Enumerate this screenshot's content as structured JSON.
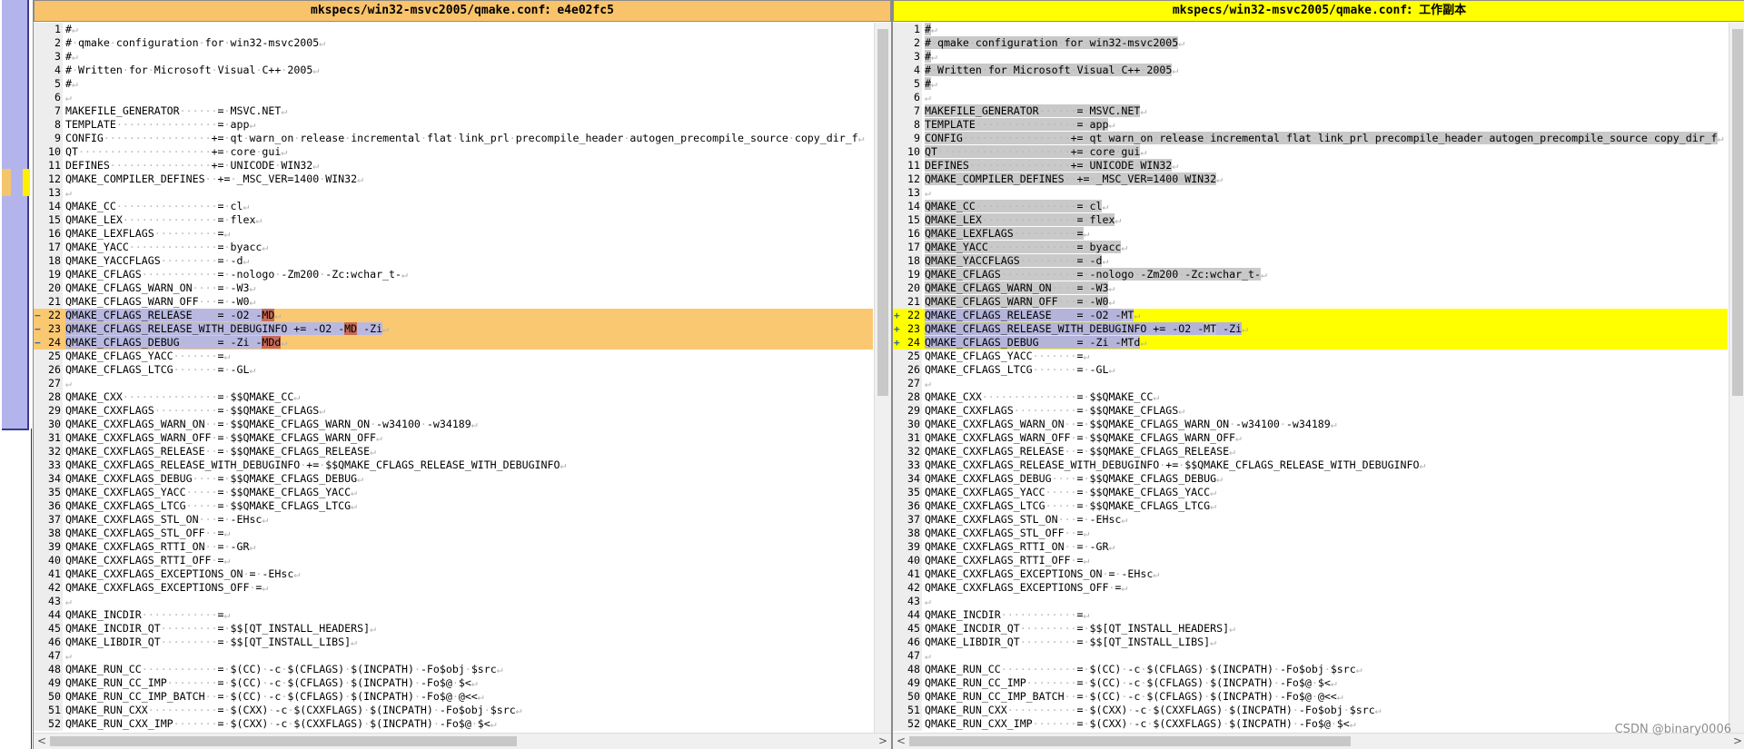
{
  "left_pane": {
    "title_path": "mkspecs/win32-msvc2005/qmake.conf",
    "title_sep": ":",
    "title_rev": "e4e02fc5",
    "lines": [
      {
        "n": 1,
        "parts": [
          [
            "#"
          ]
        ]
      },
      {
        "n": 2,
        "parts": [
          [
            "# qmake configuration for win32-msvc2005"
          ]
        ]
      },
      {
        "n": 3,
        "parts": [
          [
            "#"
          ]
        ]
      },
      {
        "n": 4,
        "parts": [
          [
            "# Written for Microsoft Visual C++ 2005"
          ]
        ]
      },
      {
        "n": 5,
        "parts": [
          [
            "#"
          ]
        ]
      },
      {
        "n": 6,
        "parts": [
          [
            ""
          ]
        ]
      },
      {
        "n": 7,
        "parts": [
          [
            "MAKEFILE_GENERATOR      = MSVC.NET"
          ]
        ]
      },
      {
        "n": 8,
        "parts": [
          [
            "TEMPLATE                = app"
          ]
        ]
      },
      {
        "n": 9,
        "parts": [
          [
            "CONFIG                 += qt warn_on release incremental flat link_prl precompile_header autogen_precompile_source copy_dir_f"
          ]
        ]
      },
      {
        "n": 10,
        "parts": [
          [
            "QT                     += core gui"
          ]
        ]
      },
      {
        "n": 11,
        "parts": [
          [
            "DEFINES                += UNICODE WIN32"
          ]
        ]
      },
      {
        "n": 12,
        "parts": [
          [
            "QMAKE_COMPILER_DEFINES  += _MSC_VER=1400 WIN32"
          ]
        ]
      },
      {
        "n": 13,
        "parts": [
          [
            ""
          ]
        ]
      },
      {
        "n": 14,
        "parts": [
          [
            "QMAKE_CC                = cl"
          ]
        ]
      },
      {
        "n": 15,
        "parts": [
          [
            "QMAKE_LEX               = flex"
          ]
        ]
      },
      {
        "n": 16,
        "parts": [
          [
            "QMAKE_LEXFLAGS          ="
          ]
        ]
      },
      {
        "n": 17,
        "parts": [
          [
            "QMAKE_YACC              = byacc"
          ]
        ]
      },
      {
        "n": 18,
        "parts": [
          [
            "QMAKE_YACCFLAGS         = -d"
          ]
        ]
      },
      {
        "n": 19,
        "parts": [
          [
            "QMAKE_CFLAGS            = -nologo -Zm200 -Zc:wchar_t-"
          ]
        ]
      },
      {
        "n": 20,
        "parts": [
          [
            "QMAKE_CFLAGS_WARN_ON    = -W3"
          ]
        ]
      },
      {
        "n": 21,
        "parts": [
          [
            "QMAKE_CFLAGS_WARN_OFF   = -W0"
          ]
        ]
      },
      {
        "n": 22,
        "marker": "−",
        "changed": true,
        "parts": [
          [
            "QMAKE_CFLAGS_RELEASE    = -O2 -",
            "hl"
          ],
          [
            "MD",
            "del"
          ]
        ]
      },
      {
        "n": 23,
        "marker": "−",
        "changed": true,
        "parts": [
          [
            "QMAKE_CFLAGS_RELEASE_WITH_DEBUGINFO += -O2 -",
            "hl"
          ],
          [
            "MD",
            "del"
          ],
          [
            " -Zi",
            "hl"
          ]
        ]
      },
      {
        "n": 24,
        "marker": "−",
        "changed": true,
        "parts": [
          [
            "QMAKE_CFLAGS_DEBUG      = -Zi -",
            "hl"
          ],
          [
            "MDd",
            "del"
          ]
        ]
      },
      {
        "n": 25,
        "parts": [
          [
            "QMAKE_CFLAGS_YACC       ="
          ]
        ]
      },
      {
        "n": 26,
        "parts": [
          [
            "QMAKE_CFLAGS_LTCG       = -GL"
          ]
        ]
      },
      {
        "n": 27,
        "parts": [
          [
            ""
          ]
        ]
      },
      {
        "n": 28,
        "parts": [
          [
            "QMAKE_CXX               = $$QMAKE_CC"
          ]
        ]
      },
      {
        "n": 29,
        "parts": [
          [
            "QMAKE_CXXFLAGS          = $$QMAKE_CFLAGS"
          ]
        ]
      },
      {
        "n": 30,
        "parts": [
          [
            "QMAKE_CXXFLAGS_WARN_ON  = $$QMAKE_CFLAGS_WARN_ON -w34100 -w34189"
          ]
        ]
      },
      {
        "n": 31,
        "parts": [
          [
            "QMAKE_CXXFLAGS_WARN_OFF = $$QMAKE_CFLAGS_WARN_OFF"
          ]
        ]
      },
      {
        "n": 32,
        "parts": [
          [
            "QMAKE_CXXFLAGS_RELEASE  = $$QMAKE_CFLAGS_RELEASE"
          ]
        ]
      },
      {
        "n": 33,
        "parts": [
          [
            "QMAKE_CXXFLAGS_RELEASE_WITH_DEBUGINFO += $$QMAKE_CFLAGS_RELEASE_WITH_DEBUGINFO"
          ]
        ]
      },
      {
        "n": 34,
        "parts": [
          [
            "QMAKE_CXXFLAGS_DEBUG    = $$QMAKE_CFLAGS_DEBUG"
          ]
        ]
      },
      {
        "n": 35,
        "parts": [
          [
            "QMAKE_CXXFLAGS_YACC     = $$QMAKE_CFLAGS_YACC"
          ]
        ]
      },
      {
        "n": 36,
        "parts": [
          [
            "QMAKE_CXXFLAGS_LTCG     = $$QMAKE_CFLAGS_LTCG"
          ]
        ]
      },
      {
        "n": 37,
        "parts": [
          [
            "QMAKE_CXXFLAGS_STL_ON   = -EHsc"
          ]
        ]
      },
      {
        "n": 38,
        "parts": [
          [
            "QMAKE_CXXFLAGS_STL_OFF  ="
          ]
        ]
      },
      {
        "n": 39,
        "parts": [
          [
            "QMAKE_CXXFLAGS_RTTI_ON  = -GR"
          ]
        ]
      },
      {
        "n": 40,
        "parts": [
          [
            "QMAKE_CXXFLAGS_RTTI_OFF ="
          ]
        ]
      },
      {
        "n": 41,
        "parts": [
          [
            "QMAKE_CXXFLAGS_EXCEPTIONS_ON = -EHsc"
          ]
        ]
      },
      {
        "n": 42,
        "parts": [
          [
            "QMAKE_CXXFLAGS_EXCEPTIONS_OFF ="
          ]
        ]
      },
      {
        "n": 43,
        "parts": [
          [
            ""
          ]
        ]
      },
      {
        "n": 44,
        "parts": [
          [
            "QMAKE_INCDIR            ="
          ]
        ]
      },
      {
        "n": 45,
        "parts": [
          [
            "QMAKE_INCDIR_QT         = $$[QT_INSTALL_HEADERS]"
          ]
        ]
      },
      {
        "n": 46,
        "parts": [
          [
            "QMAKE_LIBDIR_QT         = $$[QT_INSTALL_LIBS]"
          ]
        ]
      },
      {
        "n": 47,
        "parts": [
          [
            ""
          ]
        ]
      },
      {
        "n": 48,
        "parts": [
          [
            "QMAKE_RUN_CC            = $(CC) -c $(CFLAGS) $(INCPATH) -Fo$obj $src"
          ]
        ]
      },
      {
        "n": 49,
        "parts": [
          [
            "QMAKE_RUN_CC_IMP        = $(CC) -c $(CFLAGS) $(INCPATH) -Fo$@ $<"
          ]
        ]
      },
      {
        "n": 50,
        "parts": [
          [
            "QMAKE_RUN_CC_IMP_BATCH  = $(CC) -c $(CFLAGS) $(INCPATH) -Fo$@ @<<"
          ]
        ]
      },
      {
        "n": 51,
        "parts": [
          [
            "QMAKE_RUN_CXX           = $(CXX) -c $(CXXFLAGS) $(INCPATH) -Fo$obj $src"
          ]
        ]
      },
      {
        "n": 52,
        "parts": [
          [
            "QMAKE_RUN_CXX_IMP       = $(CXX) -c $(CXXFLAGS) $(INCPATH) -Fo$@ $<"
          ]
        ]
      }
    ]
  },
  "right_pane": {
    "title_path": "mkspecs/win32-msvc2005/qmake.conf",
    "title_sep": ":",
    "title_rev": "工作副本",
    "lines": [
      {
        "n": 1,
        "gray": true,
        "parts": [
          [
            "#",
            "hl"
          ]
        ]
      },
      {
        "n": 2,
        "gray": true,
        "parts": [
          [
            "# qmake configuration for win32-msvc2005",
            "hl"
          ]
        ]
      },
      {
        "n": 3,
        "gray": true,
        "parts": [
          [
            "#",
            "hl"
          ]
        ]
      },
      {
        "n": 4,
        "gray": true,
        "parts": [
          [
            "# Written for Microsoft Visual C++ 2005",
            "hl"
          ]
        ]
      },
      {
        "n": 5,
        "gray": true,
        "parts": [
          [
            "#",
            "hl"
          ]
        ]
      },
      {
        "n": 6,
        "parts": [
          [
            ""
          ]
        ]
      },
      {
        "n": 7,
        "gray": true,
        "parts": [
          [
            "MAKEFILE_GENERATOR      = MSVC.NET",
            "hl"
          ]
        ]
      },
      {
        "n": 8,
        "gray": true,
        "parts": [
          [
            "TEMPLATE                = app",
            "hl"
          ]
        ]
      },
      {
        "n": 9,
        "gray": true,
        "parts": [
          [
            "CONFIG                 += qt warn_on release incremental flat link_prl precompile_header autogen_precompile_source copy_dir_f",
            "hl"
          ]
        ]
      },
      {
        "n": 10,
        "gray": true,
        "parts": [
          [
            "QT                     += core gui",
            "hl"
          ]
        ]
      },
      {
        "n": 11,
        "gray": true,
        "parts": [
          [
            "DEFINES                += UNICODE WIN32",
            "hl"
          ]
        ]
      },
      {
        "n": 12,
        "gray": true,
        "parts": [
          [
            "QMAKE_COMPILER_DEFINES  += _MSC_VER=1400 WIN32",
            "hl"
          ]
        ]
      },
      {
        "n": 13,
        "parts": [
          [
            ""
          ]
        ]
      },
      {
        "n": 14,
        "gray": true,
        "parts": [
          [
            "QMAKE_CC                = cl",
            "hl"
          ]
        ]
      },
      {
        "n": 15,
        "gray": true,
        "parts": [
          [
            "QMAKE_LEX               = flex",
            "hl"
          ]
        ]
      },
      {
        "n": 16,
        "gray": true,
        "parts": [
          [
            "QMAKE_LEXFLAGS          =",
            "hl"
          ]
        ]
      },
      {
        "n": 17,
        "gray": true,
        "parts": [
          [
            "QMAKE_YACC              = byacc",
            "hl"
          ]
        ]
      },
      {
        "n": 18,
        "gray": true,
        "parts": [
          [
            "QMAKE_YACCFLAGS         = -d",
            "hl"
          ]
        ]
      },
      {
        "n": 19,
        "gray": true,
        "parts": [
          [
            "QMAKE_CFLAGS            = -nologo -Zm200 -Zc:wchar_t-",
            "hl"
          ]
        ]
      },
      {
        "n": 20,
        "gray": true,
        "parts": [
          [
            "QMAKE_CFLAGS_WARN_ON    = -W3",
            "hl"
          ]
        ]
      },
      {
        "n": 21,
        "gray": true,
        "parts": [
          [
            "QMAKE_CFLAGS_WARN_OFF   = -W0",
            "hl"
          ]
        ]
      },
      {
        "n": 22,
        "marker": "+",
        "changed": true,
        "parts": [
          [
            "QMAKE_CFLAGS_RELEASE    = -O2 -",
            "hl"
          ],
          [
            "MT",
            "del"
          ]
        ]
      },
      {
        "n": 23,
        "marker": "+",
        "changed": true,
        "parts": [
          [
            "QMAKE_CFLAGS_RELEASE_WITH_DEBUGINFO += -O2 -",
            "hl"
          ],
          [
            "MT",
            "del"
          ],
          [
            " -Zi",
            "hl"
          ]
        ]
      },
      {
        "n": 24,
        "marker": "+",
        "changed": true,
        "parts": [
          [
            "QMAKE_CFLAGS_DEBUG      = -Zi -",
            "hl"
          ],
          [
            "MTd",
            "del"
          ]
        ]
      },
      {
        "n": 25,
        "parts": [
          [
            "QMAKE_CFLAGS_YACC       ="
          ]
        ]
      },
      {
        "n": 26,
        "parts": [
          [
            "QMAKE_CFLAGS_LTCG       = -GL"
          ]
        ]
      },
      {
        "n": 27,
        "parts": [
          [
            ""
          ]
        ]
      },
      {
        "n": 28,
        "parts": [
          [
            "QMAKE_CXX               = $$QMAKE_CC"
          ]
        ]
      },
      {
        "n": 29,
        "parts": [
          [
            "QMAKE_CXXFLAGS          = $$QMAKE_CFLAGS"
          ]
        ]
      },
      {
        "n": 30,
        "parts": [
          [
            "QMAKE_CXXFLAGS_WARN_ON  = $$QMAKE_CFLAGS_WARN_ON -w34100 -w34189"
          ]
        ]
      },
      {
        "n": 31,
        "parts": [
          [
            "QMAKE_CXXFLAGS_WARN_OFF = $$QMAKE_CFLAGS_WARN_OFF"
          ]
        ]
      },
      {
        "n": 32,
        "parts": [
          [
            "QMAKE_CXXFLAGS_RELEASE  = $$QMAKE_CFLAGS_RELEASE"
          ]
        ]
      },
      {
        "n": 33,
        "parts": [
          [
            "QMAKE_CXXFLAGS_RELEASE_WITH_DEBUGINFO += $$QMAKE_CFLAGS_RELEASE_WITH_DEBUGINFO"
          ]
        ]
      },
      {
        "n": 34,
        "parts": [
          [
            "QMAKE_CXXFLAGS_DEBUG    = $$QMAKE_CFLAGS_DEBUG"
          ]
        ]
      },
      {
        "n": 35,
        "parts": [
          [
            "QMAKE_CXXFLAGS_YACC     = $$QMAKE_CFLAGS_YACC"
          ]
        ]
      },
      {
        "n": 36,
        "parts": [
          [
            "QMAKE_CXXFLAGS_LTCG     = $$QMAKE_CFLAGS_LTCG"
          ]
        ]
      },
      {
        "n": 37,
        "parts": [
          [
            "QMAKE_CXXFLAGS_STL_ON   = -EHsc"
          ]
        ]
      },
      {
        "n": 38,
        "parts": [
          [
            "QMAKE_CXXFLAGS_STL_OFF  ="
          ]
        ]
      },
      {
        "n": 39,
        "parts": [
          [
            "QMAKE_CXXFLAGS_RTTI_ON  = -GR"
          ]
        ]
      },
      {
        "n": 40,
        "parts": [
          [
            "QMAKE_CXXFLAGS_RTTI_OFF ="
          ]
        ]
      },
      {
        "n": 41,
        "parts": [
          [
            "QMAKE_CXXFLAGS_EXCEPTIONS_ON = -EHsc"
          ]
        ]
      },
      {
        "n": 42,
        "parts": [
          [
            "QMAKE_CXXFLAGS_EXCEPTIONS_OFF ="
          ]
        ]
      },
      {
        "n": 43,
        "parts": [
          [
            ""
          ]
        ]
      },
      {
        "n": 44,
        "parts": [
          [
            "QMAKE_INCDIR            ="
          ]
        ]
      },
      {
        "n": 45,
        "parts": [
          [
            "QMAKE_INCDIR_QT         = $$[QT_INSTALL_HEADERS]"
          ]
        ]
      },
      {
        "n": 46,
        "parts": [
          [
            "QMAKE_LIBDIR_QT         = $$[QT_INSTALL_LIBS]"
          ]
        ]
      },
      {
        "n": 47,
        "parts": [
          [
            ""
          ]
        ]
      },
      {
        "n": 48,
        "parts": [
          [
            "QMAKE_RUN_CC            = $(CC) -c $(CFLAGS) $(INCPATH) -Fo$obj $src"
          ]
        ]
      },
      {
        "n": 49,
        "parts": [
          [
            "QMAKE_RUN_CC_IMP        = $(CC) -c $(CFLAGS) $(INCPATH) -Fo$@ $<"
          ]
        ]
      },
      {
        "n": 50,
        "parts": [
          [
            "QMAKE_RUN_CC_IMP_BATCH  = $(CC) -c $(CFLAGS) $(INCPATH) -Fo$@ @<<"
          ]
        ]
      },
      {
        "n": 51,
        "parts": [
          [
            "QMAKE_RUN_CXX           = $(CXX) -c $(CXXFLAGS) $(INCPATH) -Fo$obj $src"
          ]
        ]
      },
      {
        "n": 52,
        "parts": [
          [
            "QMAKE_RUN_CXX_IMP       = $(CXX) -c $(CXXFLAGS) $(INCPATH) -Fo$@ $<"
          ]
        ]
      }
    ]
  },
  "scroll": {
    "left_arrow": "<",
    "right_arrow": ">"
  },
  "watermark": "CSDN @binary0006",
  "colors": {
    "left_header": "#f9c36b",
    "right_header": "#ffff00",
    "removed_line": "#fbc872",
    "added_line": "#ffff00",
    "minimap": "#b4b4ec"
  }
}
